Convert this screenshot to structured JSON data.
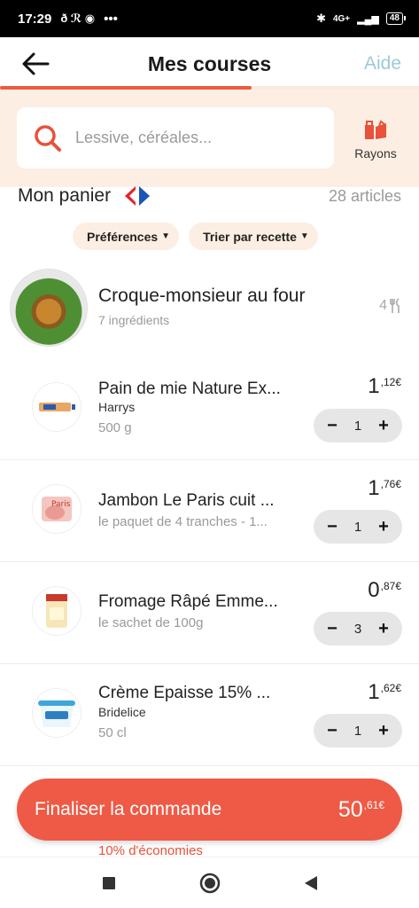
{
  "status_bar": {
    "time": "17:29",
    "battery": "48",
    "network": "4G+",
    "more": "•••"
  },
  "header": {
    "title": "Mes courses",
    "help_label": "Aide",
    "progress": 0.6
  },
  "search": {
    "placeholder": "Lessive, céréales...",
    "rayons_label": "Rayons"
  },
  "cart": {
    "title": "Mon panier",
    "count_text": "28 articles"
  },
  "chips": {
    "preferences": "Préférences",
    "sort": "Trier par recette"
  },
  "recipe": {
    "title": "Croque-monsieur au four",
    "subtitle": "7 ingrédients",
    "servings": "4"
  },
  "items": [
    {
      "name": "Pain de mie Nature Ex...",
      "brand": "Harrys",
      "quantity": "500 g",
      "price_int": "1",
      "price_dec": ",12€",
      "count": "1"
    },
    {
      "name": "Jambon Le Paris cuit ...",
      "brand": "",
      "quantity": "le paquet de 4 tranches - 1...",
      "price_int": "1",
      "price_dec": ",76€",
      "count": "1"
    },
    {
      "name": "Fromage Râpé Emme...",
      "brand": "",
      "quantity": "le sachet de 100g",
      "price_int": "0",
      "price_dec": ",87€",
      "count": "3"
    },
    {
      "name": "Crème Epaisse 15% ...",
      "brand": "Bridelice",
      "quantity": "50 cl",
      "price_int": "1",
      "price_dec": ",62€",
      "count": "1"
    }
  ],
  "savings_text": "10% d'économies",
  "checkout": {
    "label": "Finaliser la commande",
    "total_int": "50",
    "total_dec": ",61€"
  },
  "colors": {
    "accent": "#ee5a45",
    "band": "#fdeee3",
    "help": "#9ccbd8"
  }
}
